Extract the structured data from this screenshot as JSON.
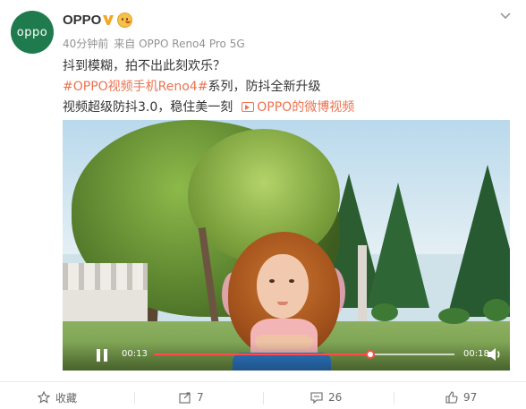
{
  "post": {
    "avatar_text": "oppo",
    "username": "OPPO",
    "meta_time": "40分钟前",
    "meta_source": "来自 OPPO Reno4 Pro 5G",
    "line1": "抖到模糊，拍不出此刻欢乐？",
    "line2_topic": "#OPPO视频手机Reno4#",
    "line2_rest": "系列，防抖全新升级",
    "line3_text": "视频超级防抖3.0，稳住美一刻",
    "line3_link": "OPPO的微博视频"
  },
  "video": {
    "current_time": "00:13",
    "total_time": "00:18",
    "progress": 0.72
  },
  "actions": {
    "favorite_label": "收藏",
    "forward_count": "7",
    "comment_count": "26",
    "like_count": "97"
  },
  "colors": {
    "accent": "#eb7350",
    "verified": "#f5a623",
    "avatar_bg": "#1f7a4d",
    "progress": "#ff4b4b"
  }
}
